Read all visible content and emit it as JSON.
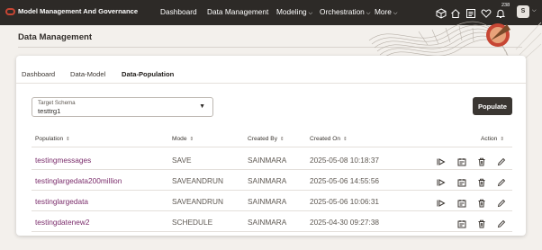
{
  "app": {
    "title": "Model Management And Governance"
  },
  "nav": {
    "dashboard": "Dashboard",
    "data_management": "Data Management",
    "modeling": "Modeling",
    "orchestration": "Orchestration",
    "more": "More"
  },
  "notifications_count": "238",
  "user_initial": "S",
  "page_title": "Data Management",
  "tabs": [
    "Dashboard",
    "Data-Model",
    "Data-Population"
  ],
  "active_tab": "Data-Population",
  "schema": {
    "label": "Target Schema",
    "value": "testtrg1"
  },
  "populate_label": "Populate",
  "table": {
    "headers": {
      "population": "Population",
      "mode": "Mode",
      "created_by": "Created By",
      "created_on": "Created On",
      "action": "Action"
    },
    "rows": [
      {
        "population": "testingmessages",
        "mode": "SAVE",
        "created_by": "SAINMARA",
        "created_on": "2025-05-08 10:18:37",
        "has_run": true
      },
      {
        "population": "testinglargedata200million",
        "mode": "SAVEANDRUN",
        "created_by": "SAINMARA",
        "created_on": "2025-05-06 14:55:56",
        "has_run": true
      },
      {
        "population": "testinglargedata",
        "mode": "SAVEANDRUN",
        "created_by": "SAINMARA",
        "created_on": "2025-05-06 10:06:31",
        "has_run": true
      },
      {
        "population": "testingdatenew2",
        "mode": "SCHEDULE",
        "created_by": "SAINMARA",
        "created_on": "2025-04-30 09:27:38",
        "has_run": false
      }
    ]
  },
  "icons": [
    "oracle-logo-icon",
    "cube-icon",
    "home-icon",
    "list-icon",
    "heart-icon",
    "bell-icon",
    "run-icon",
    "schedule-icon",
    "delete-icon",
    "edit-icon",
    "sort-icon"
  ],
  "colors": {
    "topbar": "#2d2a27",
    "brand": "#c74634",
    "link": "#7a2c6b",
    "button": "#3a3632"
  }
}
